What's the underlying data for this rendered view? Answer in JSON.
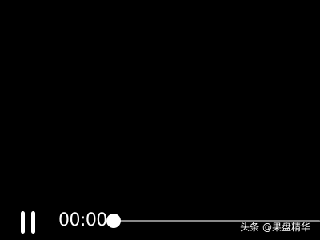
{
  "player": {
    "state": "playing",
    "current_time": "00:00",
    "progress_fraction": 0.0
  },
  "controls": {
    "pause_icon": "pause-icon"
  },
  "watermark": {
    "text": "头条 @果盘精华"
  },
  "colors": {
    "background": "#000000",
    "icon": "#ffffff",
    "time_text": "#ffffff",
    "track": "#8a8a8a",
    "fill": "#ffffff",
    "thumb": "#ffffff",
    "watermark": "#ffffff"
  }
}
